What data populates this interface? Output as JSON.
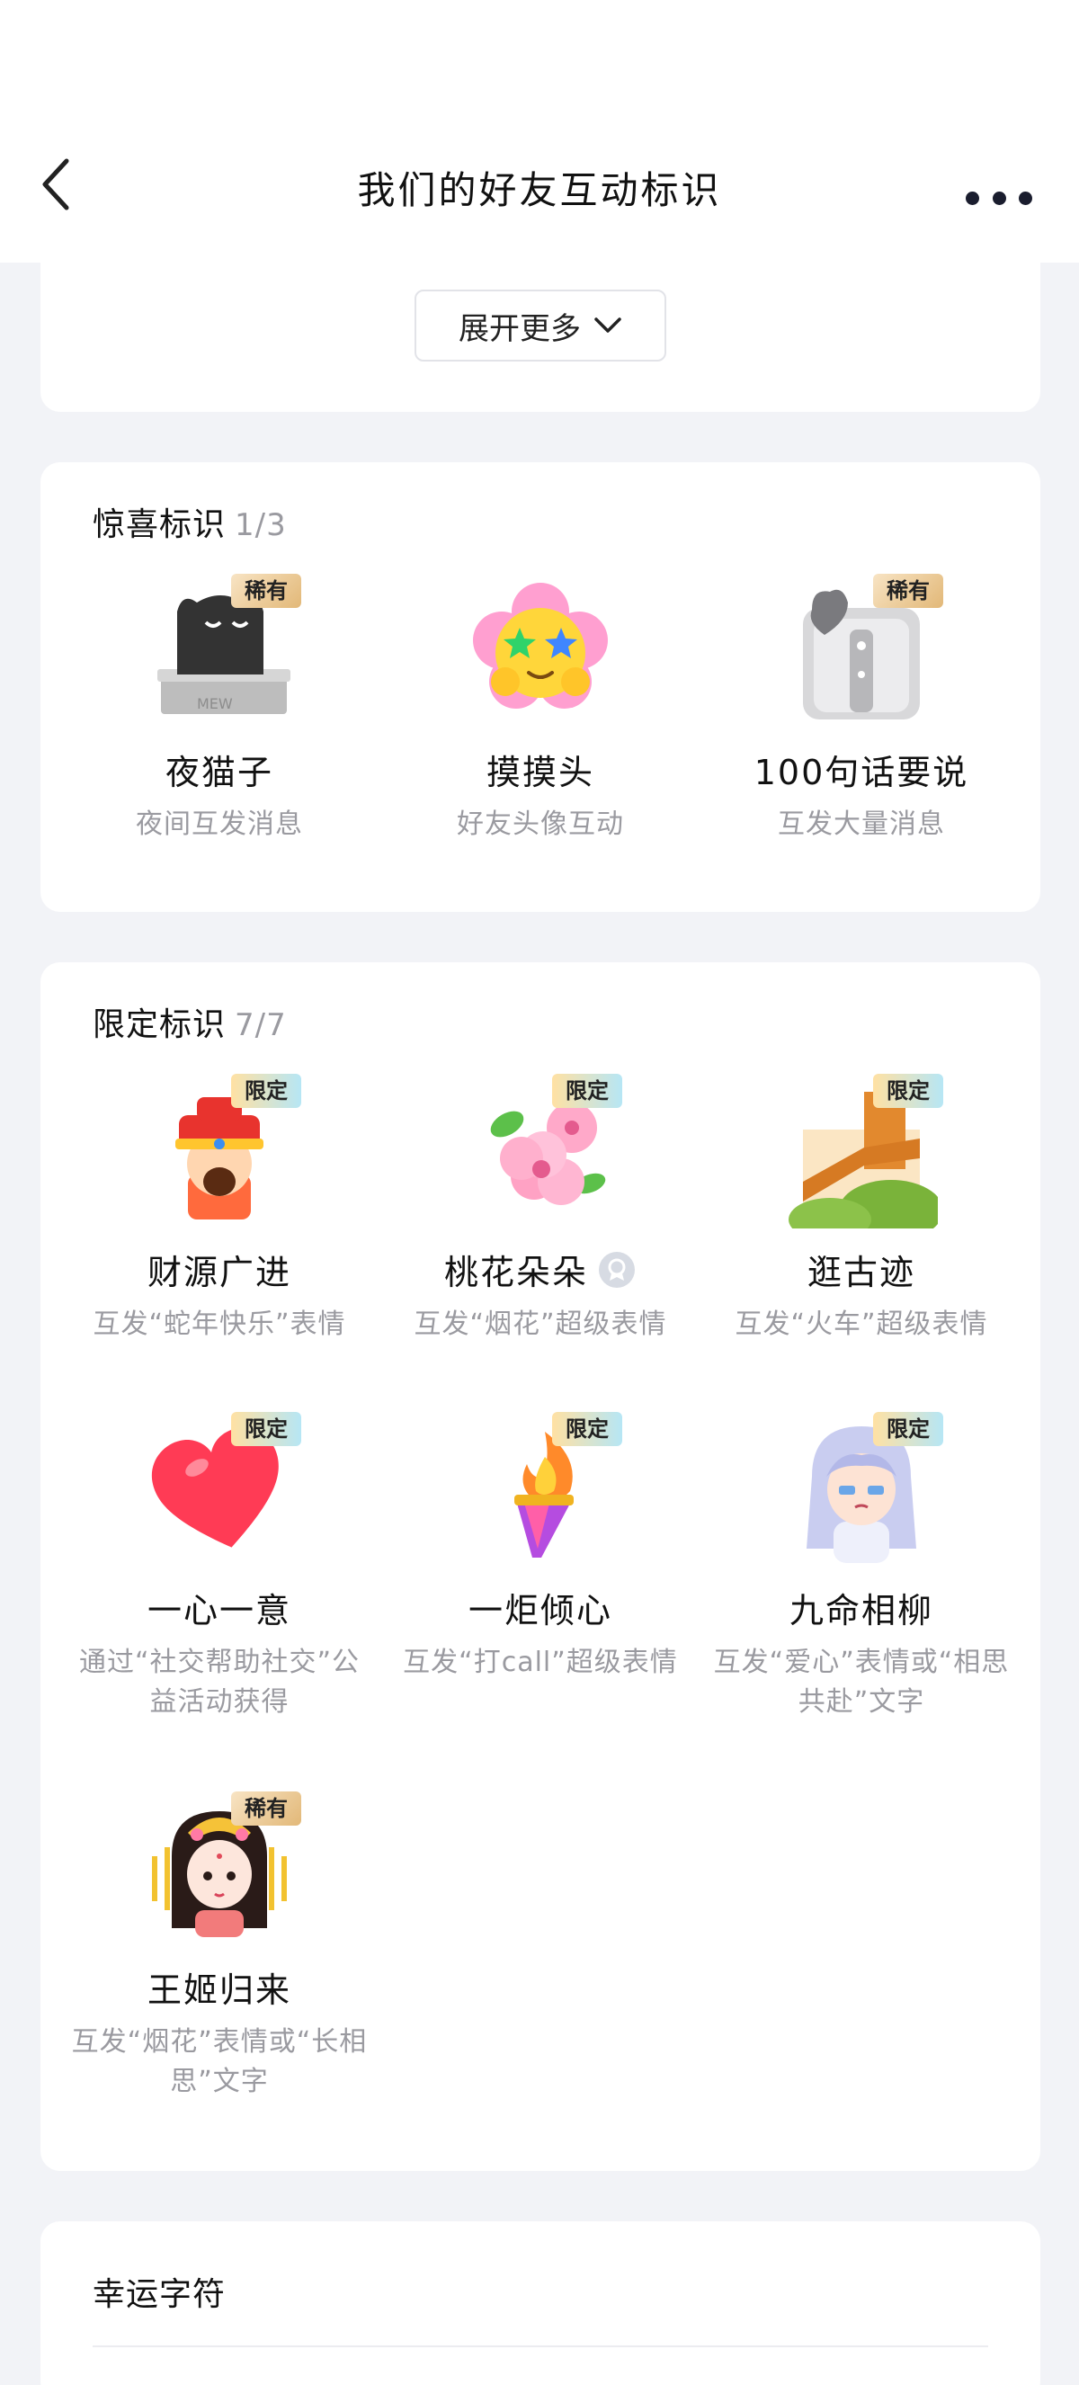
{
  "header": {
    "title": "我们的好友互动标识"
  },
  "expand": {
    "label": "展开更多"
  },
  "surprise": {
    "title": "惊喜标识",
    "count": "1/3",
    "badges": [
      {
        "name": "夜猫子",
        "desc": "夜间互发消息",
        "tag": "稀有",
        "icon": "night-cat-icon"
      },
      {
        "name": "摸摸头",
        "desc": "好友头像互动",
        "tag": "",
        "icon": "flower-face-icon"
      },
      {
        "name": "100句话要说",
        "desc": "互发大量消息",
        "tag": "稀有",
        "icon": "chat-box-icon"
      }
    ]
  },
  "limited": {
    "title": "限定标识",
    "count": "7/7",
    "badges": [
      {
        "name": "财源广进",
        "desc": "互发“蛇年快乐”表情",
        "tag": "限定",
        "icon": "fortune-god-icon"
      },
      {
        "name": "桃花朵朵",
        "desc": "互发“烟花”超级表情",
        "tag": "限定",
        "icon": "peach-blossom-icon"
      },
      {
        "name": "逛古迹",
        "desc": "互发“火车”超级表情",
        "tag": "限定",
        "icon": "great-wall-icon"
      },
      {
        "name": "一心一意",
        "desc": "通过“社交帮助社交”公益活动获得",
        "tag": "限定",
        "icon": "heart-icon"
      },
      {
        "name": "一炬倾心",
        "desc": "互发“打call”超级表情",
        "tag": "限定",
        "icon": "torch-icon"
      },
      {
        "name": "九命相柳",
        "desc": "互发“爱心”表情或“相思共赴”文字",
        "tag": "限定",
        "icon": "silver-hair-character-icon"
      },
      {
        "name": "王姬归来",
        "desc": "互发“烟花”表情或“长相思”文字",
        "tag": "稀有",
        "icon": "princess-character-icon"
      }
    ]
  },
  "lucky": {
    "title": "幸运字符"
  },
  "colors": {
    "background": "#f2f3f7",
    "card": "#ffffff",
    "muted_text": "#9a9aa0"
  }
}
